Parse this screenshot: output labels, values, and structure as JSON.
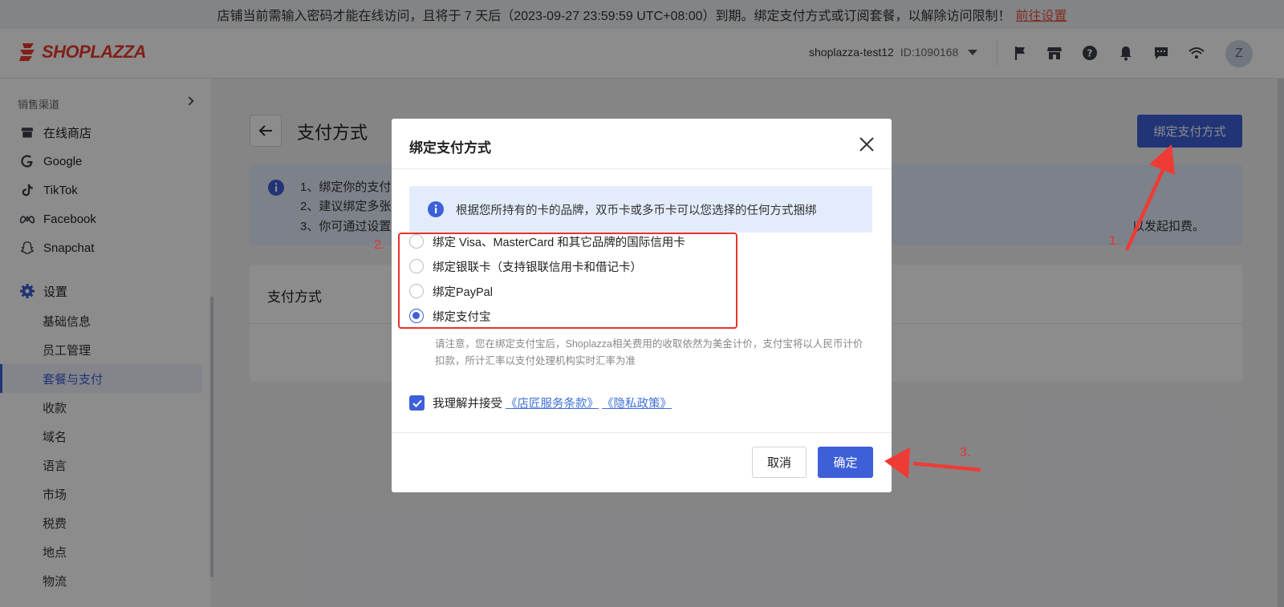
{
  "notice": {
    "text": "店铺当前需输入密码才能在线访问，且将于 7 天后（2023-09-27 23:59:59 UTC+08:00）到期。绑定支付方式或订阅套餐，以解除访问限制！",
    "link": "前往设置"
  },
  "header": {
    "logo_text": "SHOPLAZZA",
    "store_name": "shoplazza-test12",
    "store_id": "ID:1090168",
    "avatar": "Z",
    "icons": [
      "flag-icon",
      "store-icon",
      "help-icon",
      "bell-icon",
      "message-icon",
      "wifi-icon"
    ]
  },
  "sidebar": {
    "section": "销售渠道",
    "channels": [
      "在线商店",
      "Google",
      "TikTok",
      "Facebook",
      "Snapchat"
    ],
    "settings_label": "设置",
    "settings_items": [
      "基础信息",
      "员工管理",
      "套餐与支付",
      "收款",
      "域名",
      "语言",
      "市场",
      "税费",
      "地点",
      "物流"
    ],
    "active_item": "套餐与支付"
  },
  "page": {
    "title": "支付方式",
    "bind_button": "绑定支付方式",
    "info_lines": [
      "1、绑定你的支付",
      "2、建议绑定多张",
      "3、你可通过设置"
    ],
    "info_tail": "以发起扣费。",
    "card_title": "支付方式"
  },
  "modal": {
    "title": "绑定支付方式",
    "info": "根据您所持有的卡的品牌，双币卡或多币卡可以您选择的任何方式捆绑",
    "options": [
      "绑定 Visa、MasterCard 和其它品牌的国际信用卡",
      "绑定银联卡（支持银联信用卡和借记卡）",
      "绑定PayPal",
      "绑定支付宝"
    ],
    "selected_index": 3,
    "note": "请注意，您在绑定支付宝后，Shoplazza相关费用的收取依然为美金计价，支付宝将以人民币计价扣款，所计汇率以支付处理机构实时汇率为准",
    "agree_text": "我理解并接受",
    "terms_link": "《店匠服务条款》",
    "privacy_link": "《隐私政策》",
    "cancel": "取消",
    "ok": "确定"
  },
  "annotations": {
    "step1": "1.",
    "step2": "2.",
    "step3": "3.",
    "color": "#e8332a"
  }
}
